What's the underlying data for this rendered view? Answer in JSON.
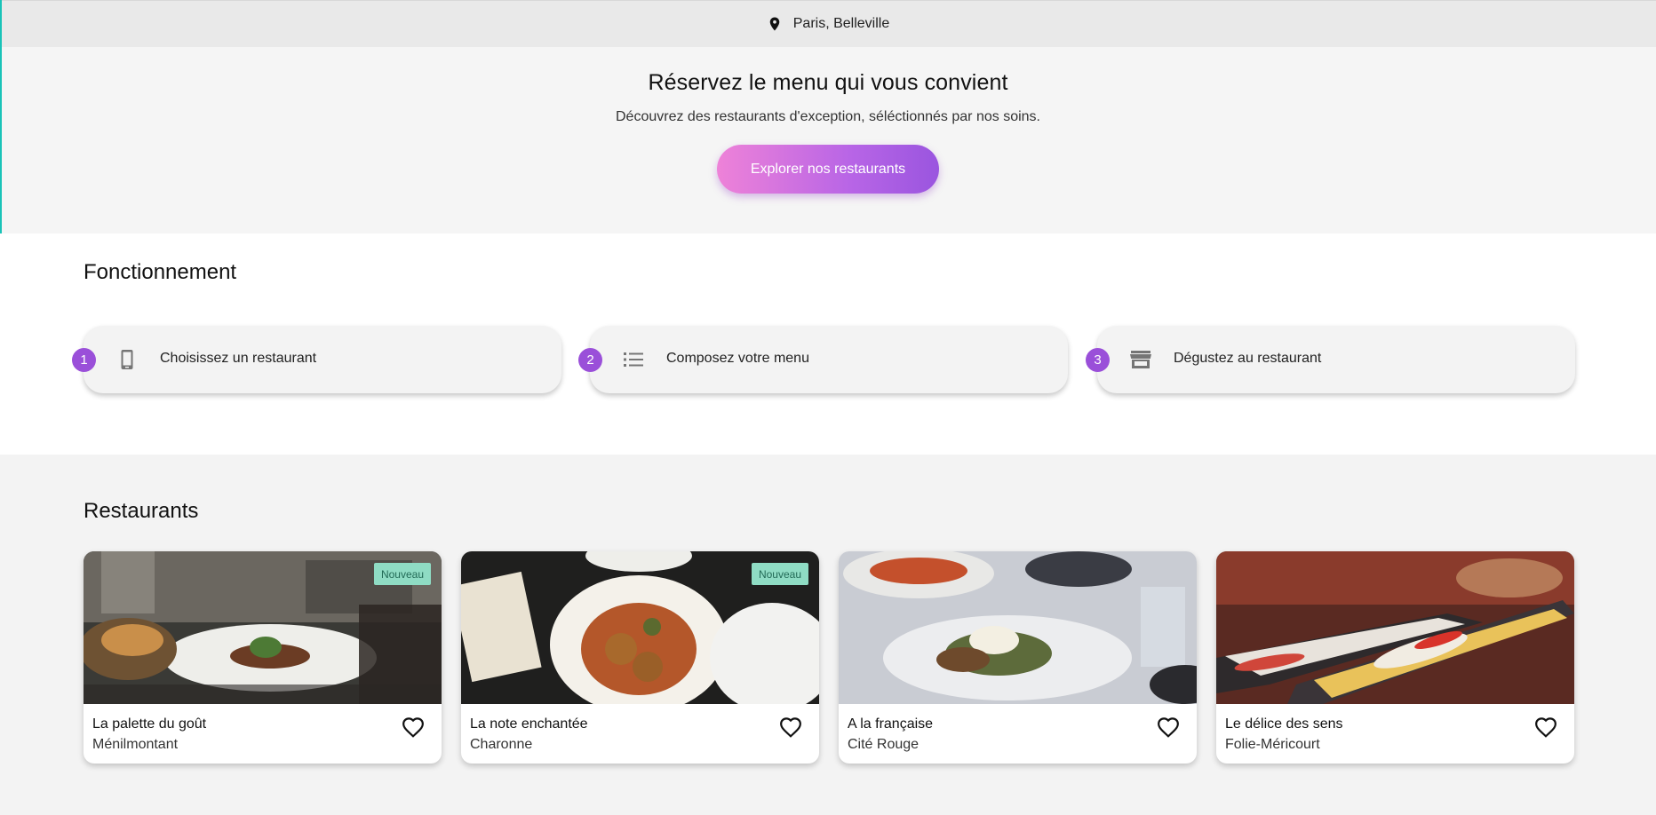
{
  "location": {
    "label": "Paris, Belleville",
    "icon": "map-pin-icon"
  },
  "hero": {
    "title": "Réservez le menu qui vous convient",
    "subtitle": "Découvrez des restaurants d'exception, séléctionnés par nos soins.",
    "cta_label": "Explorer nos restaurants"
  },
  "how_it_works": {
    "title": "Fonctionnement",
    "steps": [
      {
        "number": "1",
        "label": "Choisissez un restaurant",
        "icon": "smartphone-icon"
      },
      {
        "number": "2",
        "label": "Composez votre menu",
        "icon": "list-icon"
      },
      {
        "number": "3",
        "label": "Dégustez au restaurant",
        "icon": "storefront-icon"
      }
    ]
  },
  "restaurants": {
    "title": "Restaurants",
    "items": [
      {
        "name": "La palette du goût",
        "area": "Ménilmontant",
        "badge": "Nouveau"
      },
      {
        "name": "La note enchantée",
        "area": "Charonne",
        "badge": "Nouveau"
      },
      {
        "name": "A la française",
        "area": "Cité Rouge",
        "badge": ""
      },
      {
        "name": "Le délice des sens",
        "area": "Folie-Méricourt",
        "badge": ""
      }
    ]
  },
  "colors": {
    "accent_purple": "#9a4fd9",
    "cta_gradient_start": "#ee82d8",
    "cta_gradient_end": "#9a55df",
    "badge_bg": "#8fdcc4"
  }
}
